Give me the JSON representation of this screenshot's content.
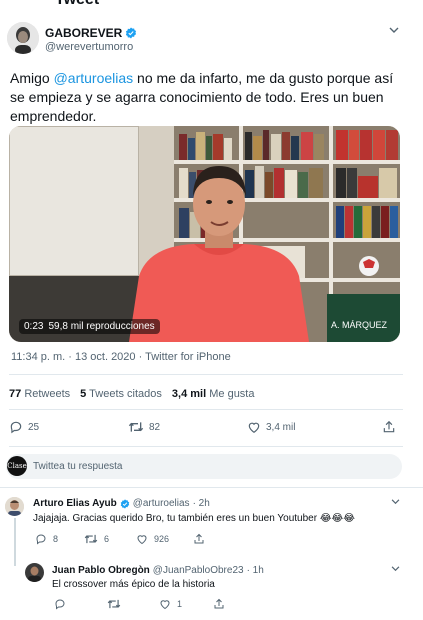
{
  "header_cut": "Tweet",
  "author": {
    "name": "GABOREVER",
    "handle": "@werevertumorro"
  },
  "tweet": {
    "text_before": "Amigo ",
    "mention": "@arturoelias",
    "text_after": " no me da infarto, me da gusto porque así se empieza y se agarra conocimiento de todo. Eres un buen emprendedor."
  },
  "video": {
    "time": "0:23",
    "views": "59,8 mil reproducciones",
    "shirt_text": "A. MÁRQUEZ"
  },
  "meta": "11:34 p. m. · 13 oct. 2020 · Twitter for iPhone",
  "stats": {
    "retweets_count": "77",
    "retweets_label": "Retweets",
    "quotes_count": "5",
    "quotes_label": "Tweets citados",
    "likes_count": "3,4 mil",
    "likes_label": "Me gusta"
  },
  "actions": {
    "replies": "25",
    "retweets": "82",
    "likes": "3,4 mil"
  },
  "reply_box": {
    "avatar_text": "Clase",
    "placeholder": "Twittea tu respuesta"
  },
  "replies": [
    {
      "name": "Arturo Elias Ayub",
      "handle": "@arturoelias",
      "time": "· 2h",
      "text": "Jajajaja.  Gracias querido Bro, tu también eres un buen Youtuber 😂😂😂",
      "replies": "8",
      "retweets": "6",
      "likes": "926"
    },
    {
      "name": "Juan Pablo Obregòn",
      "handle": "@JuanPabloObre23",
      "time": "· 1h",
      "text": "El crossover más épico de la historia",
      "replies": "",
      "retweets": "",
      "likes": "1"
    }
  ],
  "colors": {
    "link": "#1b95e0",
    "verified": "#1da1f2",
    "muted": "#536471"
  }
}
